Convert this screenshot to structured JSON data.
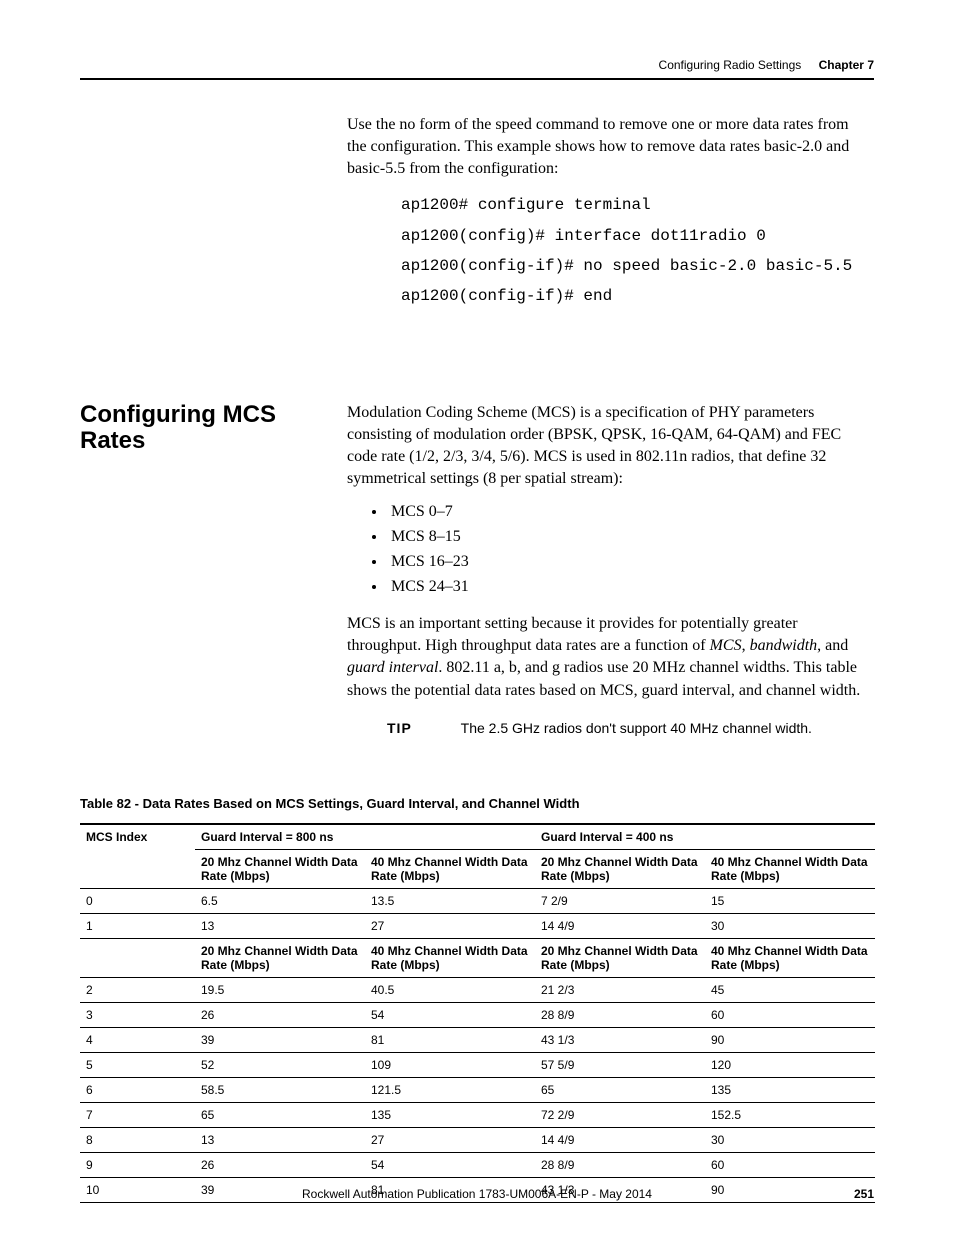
{
  "header": {
    "section": "Configuring Radio Settings",
    "chapter_label": "Chapter 7"
  },
  "intro_para": "Use the no form of the speed command to remove one or more data rates from the configuration. This example shows how to remove data rates basic-2.0 and basic-5.5 from the configuration:",
  "code_block": "ap1200# configure terminal\nap1200(config)# interface dot11radio 0\nap1200(config-if)# no speed basic-2.0 basic-5.5\nap1200(config-if)# end",
  "section": {
    "heading": "Configuring MCS Rates",
    "para1": "Modulation Coding Scheme (MCS) is a specification of PHY parameters consisting of modulation order (BPSK, QPSK, 16-QAM, 64-QAM) and FEC code rate (1/2, 2/3, 3/4, 5/6). MCS is used in 802.11n radios, that define 32 symmetrical settings (8 per spatial stream):",
    "bullets": [
      "MCS 0–7",
      "MCS 8–15",
      "MCS 16–23",
      "MCS 24–31"
    ],
    "para2_html": "MCS is an important setting because it provides for potentially greater throughput. High throughput data rates are a function of <i>MCS</i>, <i>bandwidth</i>, and <i>guard interval</i>. 802.11 a, b, and g radios use 20 MHz channel widths. This table shows the potential data rates based on MCS, guard interval, and channel width.",
    "tip_label": "TIP",
    "tip_text": "The 2.5 GHz radios don't support 40 MHz channel width."
  },
  "table": {
    "caption": "Table 82 - Data Rates Based on MCS Settings, Guard Interval, and Channel Width",
    "head": {
      "mcs": "MCS Index",
      "g800": "Guard Interval = 800 ns",
      "g400": "Guard Interval = 400 ns",
      "c20": "20 Mhz Channel Width Data Rate (Mbps)",
      "c40": "40 Mhz Channel Width Data Rate (Mbps)"
    },
    "rows1": [
      {
        "mcs": "0",
        "a": "6.5",
        "b": "13.5",
        "c": "7 2/9",
        "d": "15"
      },
      {
        "mcs": "1",
        "a": "13",
        "b": "27",
        "c": "14 4/9",
        "d": "30"
      }
    ],
    "rows2": [
      {
        "mcs": "2",
        "a": "19.5",
        "b": "40.5",
        "c": "21 2/3",
        "d": "45"
      },
      {
        "mcs": "3",
        "a": "26",
        "b": "54",
        "c": "28 8/9",
        "d": "60"
      },
      {
        "mcs": "4",
        "a": "39",
        "b": "81",
        "c": "43 1/3",
        "d": "90"
      },
      {
        "mcs": "5",
        "a": "52",
        "b": "109",
        "c": "57 5/9",
        "d": "120"
      },
      {
        "mcs": "6",
        "a": "58.5",
        "b": "121.5",
        "c": "65",
        "d": "135"
      },
      {
        "mcs": "7",
        "a": "65",
        "b": "135",
        "c": "72 2/9",
        "d": "152.5"
      },
      {
        "mcs": "8",
        "a": "13",
        "b": "27",
        "c": "14 4/9",
        "d": "30"
      },
      {
        "mcs": "9",
        "a": "26",
        "b": "54",
        "c": "28 8/9",
        "d": "60"
      },
      {
        "mcs": "10",
        "a": "39",
        "b": "81",
        "c": "43 1/3",
        "d": "90"
      }
    ]
  },
  "footer": {
    "publication": "Rockwell Automation Publication 1783-UM006A-EN-P - May 2014",
    "page": "251"
  }
}
